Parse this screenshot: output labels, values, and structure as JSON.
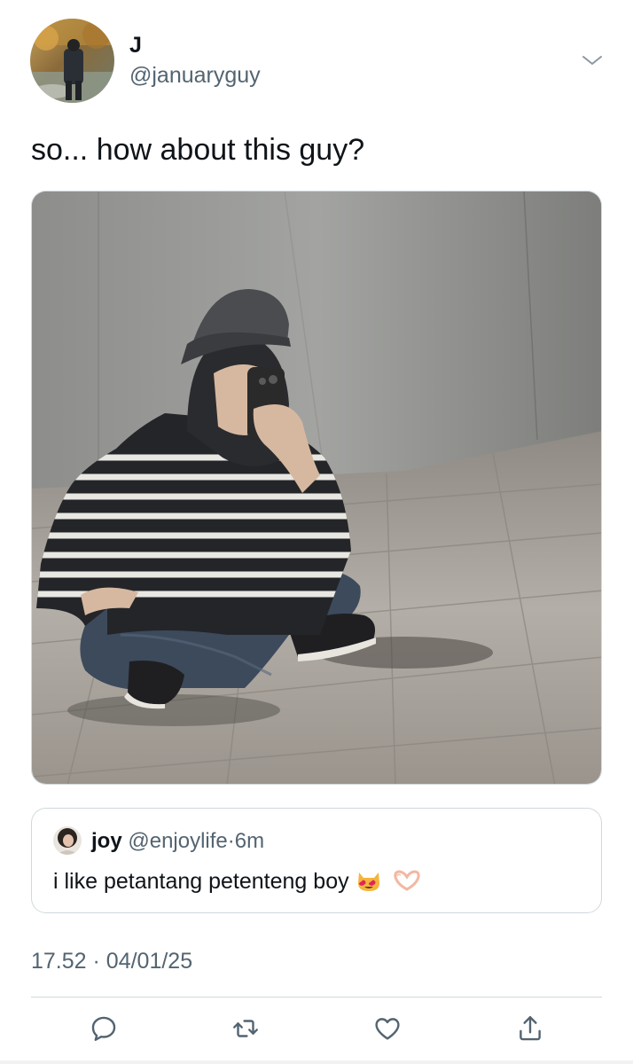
{
  "author": {
    "display_name": "J",
    "handle": "@januaryguy"
  },
  "tweet": {
    "text": "so... how about this guy?",
    "timestamp": "17.52",
    "separator": "·",
    "date": "04/01/25"
  },
  "quote": {
    "display_name": "joy",
    "handle": "@enjoylife",
    "separator": "·",
    "time": "6m",
    "text": "i like petantang petenteng boy",
    "emojis": [
      "heart-eyes-cat",
      "heart-hands"
    ]
  },
  "icons": {
    "more": "chevron-down-icon",
    "reply": "speech-bubble-icon",
    "retweet": "retweet-icon",
    "like": "heart-icon",
    "share": "share-icon"
  },
  "colors": {
    "text_primary": "#0f1419",
    "text_secondary": "#536471",
    "border": "#cfd9de"
  }
}
